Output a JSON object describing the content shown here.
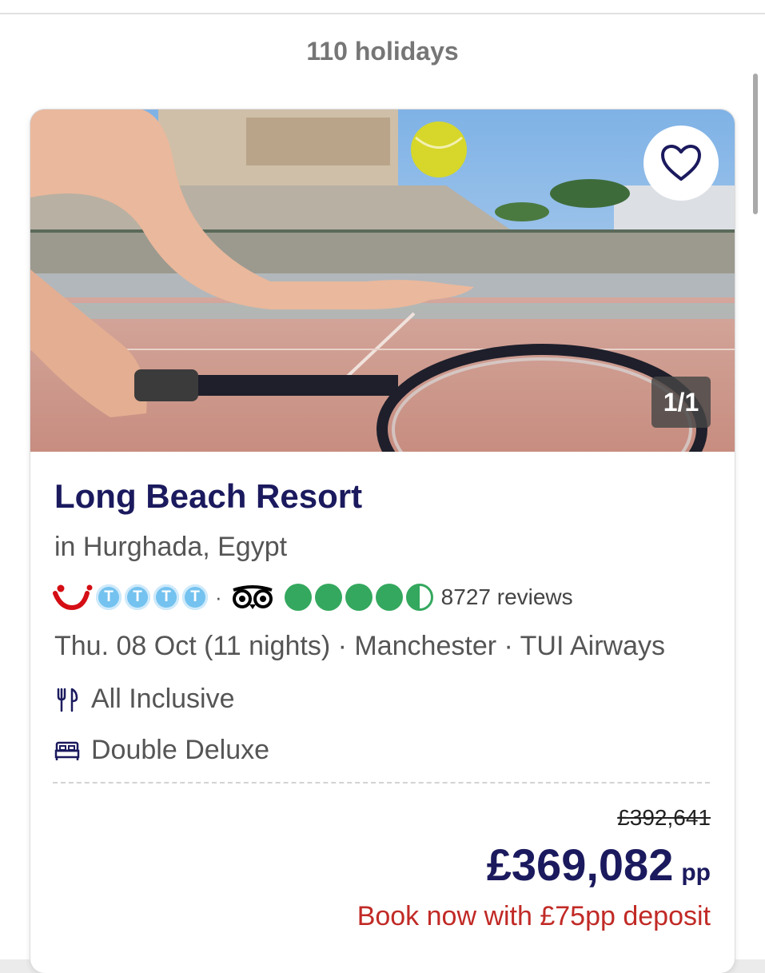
{
  "results": {
    "count_label": "110 holidays"
  },
  "card": {
    "gallery_counter": "1/1",
    "hotel_name": "Long Beach Resort",
    "location": "in Hurghada, Egypt",
    "tui_rating": {
      "value": 4,
      "max": 4,
      "dot_glyph": "T"
    },
    "separator": "·",
    "tripadvisor": {
      "rating": 4.5,
      "max": 5,
      "reviews": "8727 reviews"
    },
    "trip_info": "Thu. 08 Oct (11 nights) · Manchester · TUI Airways",
    "board": "All Inclusive",
    "room": "Double Deluxe",
    "old_price": "£392,641",
    "price": "£369,082",
    "price_unit": "pp",
    "deposit_text": "Book now with £75pp deposit"
  },
  "icons": {
    "favourite": "heart-outline-icon",
    "board": "cutlery-icon",
    "room": "bed-icon"
  },
  "colors": {
    "brand_navy": "#1b1a5e",
    "tui_red": "#d40e14",
    "tui_blue": "#74c2ef",
    "tripadvisor_green": "#34a85e",
    "deposit_red": "#c12a26"
  }
}
